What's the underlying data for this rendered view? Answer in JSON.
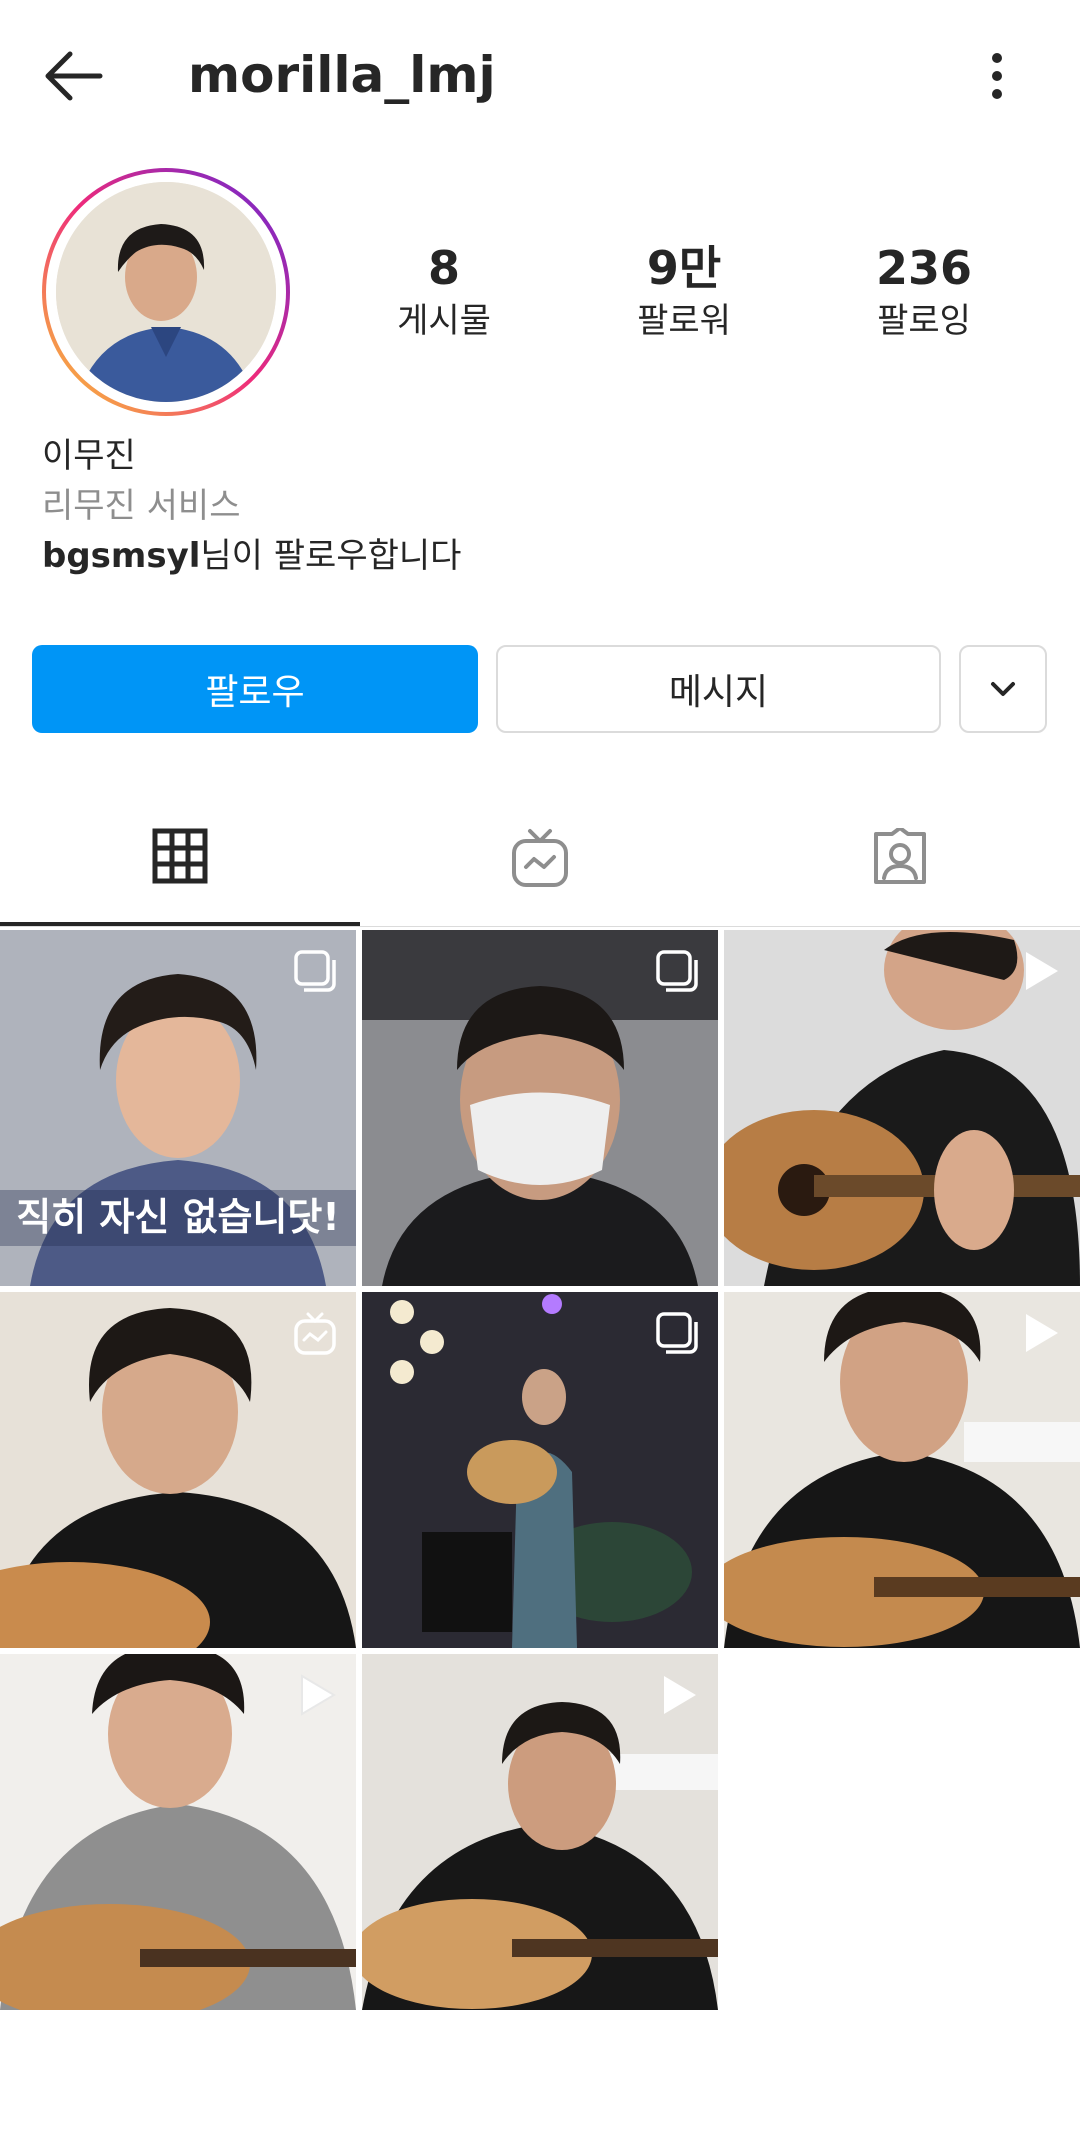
{
  "header": {
    "username": "morilla_lmj"
  },
  "profile": {
    "stats": [
      {
        "value": "8",
        "label": "게시물"
      },
      {
        "value": "9만",
        "label": "팔로워"
      },
      {
        "value": "236",
        "label": "팔로잉"
      }
    ],
    "name": "이무진",
    "category": "리무진 서비스",
    "followed_by_user": "bgsmsyl",
    "followed_by_suffix": "님이 팔로우합니다"
  },
  "actions": {
    "follow_label": "팔로우",
    "message_label": "메시지"
  },
  "tabs": [
    {
      "icon": "grid-icon",
      "active": true
    },
    {
      "icon": "igtv-icon",
      "active": false
    },
    {
      "icon": "tagged-icon",
      "active": false
    }
  ],
  "posts": [
    {
      "badge": "carousel",
      "caption_overlay": "직히 자신 없습니닷!"
    },
    {
      "badge": "carousel"
    },
    {
      "badge": "video"
    },
    {
      "badge": "igtv"
    },
    {
      "badge": "carousel"
    },
    {
      "badge": "video"
    },
    {
      "badge": "video"
    },
    {
      "badge": "video"
    }
  ],
  "colors": {
    "accent": "#0095f6",
    "text": "#262626",
    "muted": "#8e8e8e",
    "border": "#dbdbdb"
  }
}
